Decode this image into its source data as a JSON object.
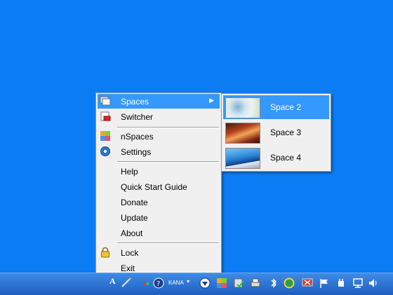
{
  "menu": {
    "items": [
      {
        "label": "Spaces",
        "icon": "windows-icon"
      },
      {
        "label": "Switcher",
        "icon": "switcher-icon"
      },
      {
        "label": "nSpaces",
        "icon": "nspaces-logo-icon"
      },
      {
        "label": "Settings",
        "icon": "gear-icon"
      },
      {
        "label": "Help"
      },
      {
        "label": "Quick Start Guide"
      },
      {
        "label": "Donate"
      },
      {
        "label": "Update"
      },
      {
        "label": "About"
      },
      {
        "label": "Lock",
        "icon": "padlock-icon"
      },
      {
        "label": "Exit"
      }
    ],
    "highlight_color": "#3399ff"
  },
  "submenu": {
    "items": [
      {
        "label": "Space 2",
        "thumbnail": "abstract-wallpaper-thumbnail"
      },
      {
        "label": "Space 3",
        "thumbnail": "canyon-wallpaper-thumbnail"
      },
      {
        "label": "Space 4",
        "thumbnail": "blue-boat-wallpaper-thumbnail"
      }
    ]
  },
  "taskbar": {
    "ime_text": "A",
    "kana_text": "KANA"
  },
  "colors": {
    "desktop": "#0b7cf4",
    "menu_bg": "#f0f0f0"
  }
}
